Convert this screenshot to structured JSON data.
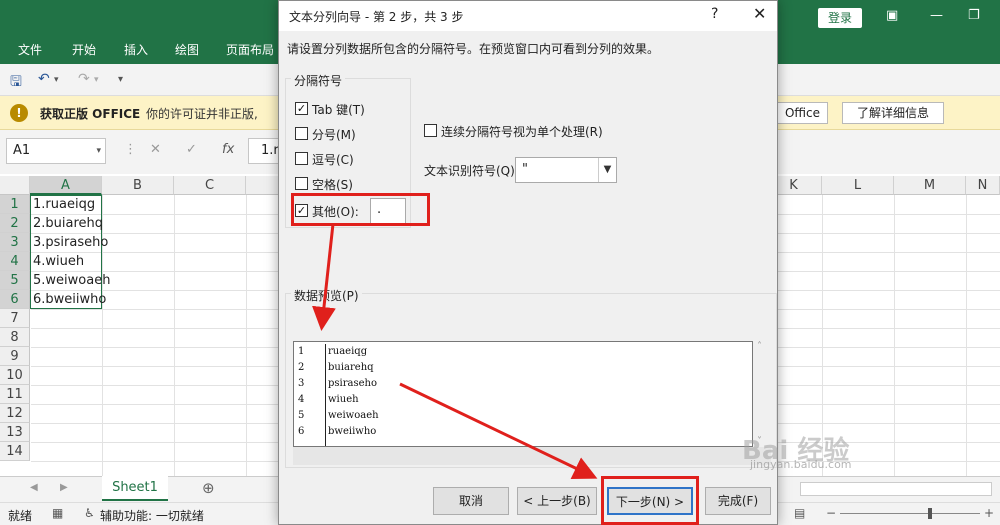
{
  "excel": {
    "login_label": "登录",
    "ribbon_tabs": [
      "文件",
      "开始",
      "插入",
      "绘图",
      "页面布局"
    ],
    "info_bar": {
      "title": "获取正版 OFFICE",
      "text": "你的许可证并非正版,",
      "btn_partial": "Office",
      "btn_more": "了解详细信息"
    },
    "name_box": "A1",
    "formula_partial": "1.r",
    "columns_left": [
      "A",
      "B",
      "C"
    ],
    "columns_right": [
      "K",
      "L",
      "M",
      "N"
    ],
    "rows": [
      "1",
      "2",
      "3",
      "4",
      "5",
      "6",
      "7",
      "8",
      "9",
      "10",
      "11",
      "12",
      "13",
      "14"
    ],
    "cells": [
      "1.ruaeiqg",
      "2.buiarehq",
      "3.psiraseho",
      "4.wiueh",
      "5.weiwoaeh",
      "6.bweiiwho"
    ],
    "sheet_tab": "Sheet1",
    "add_sheet_icon": "⊕",
    "status_ready": "就绪",
    "status_accessibility": "辅助功能: 一切就绪"
  },
  "dialog": {
    "title": "文本分列向导 - 第 2 步，共 3 步",
    "help": "?",
    "close": "✕",
    "instruction": "请设置分列数据所包含的分隔符号。在预览窗口内可看到分列的效果。",
    "delimiters_legend": "分隔符号",
    "delimiters": [
      {
        "label": "Tab 键(T)",
        "checked": true
      },
      {
        "label": "分号(M)",
        "checked": false
      },
      {
        "label": "逗号(C)",
        "checked": false
      },
      {
        "label": "空格(S)",
        "checked": false
      },
      {
        "label": "其他(O):",
        "checked": true
      }
    ],
    "other_value": ".",
    "consecutive_label": "连续分隔符号视为单个处理(R)",
    "consecutive_checked": false,
    "qualifier_label": "文本识别符号(Q):",
    "qualifier_value": "\"",
    "preview_legend": "数据预览(P)",
    "preview_rows": [
      {
        "num": "1",
        "text": "ruaeiqg"
      },
      {
        "num": "2",
        "text": "buiarehq"
      },
      {
        "num": "3",
        "text": "psiraseho"
      },
      {
        "num": "4",
        "text": "wiueh"
      },
      {
        "num": "5",
        "text": "weiwoaeh"
      },
      {
        "num": "6",
        "text": "bweiiwho"
      }
    ],
    "buttons": {
      "cancel": "取消",
      "back": "< 上一步(B)",
      "next": "下一步(N) >",
      "finish": "完成(F)"
    }
  },
  "annotation_color": "#e0201c",
  "watermark": "Bai 经验",
  "watermark_sub": "jingyan.baidu.com"
}
